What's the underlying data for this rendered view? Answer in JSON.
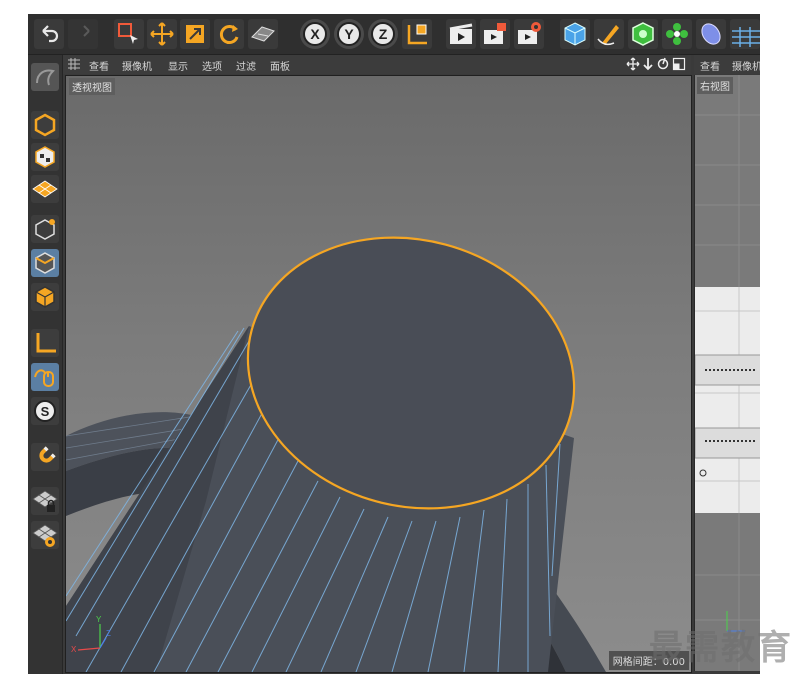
{
  "toolbar": {
    "axis_labels": [
      "X",
      "Y",
      "Z"
    ],
    "icons": [
      "undo-icon",
      "redo-icon",
      "live-select-icon",
      "move-icon",
      "scale-icon",
      "rotate-icon",
      "recent-tool-icon",
      "x-axis-lock-icon",
      "y-axis-lock-icon",
      "z-axis-lock-icon",
      "coordinate-system-icon",
      "render-view-icon",
      "render-to-picture-viewer-icon",
      "render-settings-icon",
      "cube-icon",
      "pen-spline-icon",
      "subdivision-surface-icon",
      "cloner-icon",
      "deformer-icon",
      "floor-icon"
    ]
  },
  "palette": {
    "icons": [
      "model-mode-icon",
      "object-mode-icon",
      "texture-mode-icon",
      "workplane-icon",
      "points-mode-icon",
      "edges-mode-icon",
      "polygons-mode-icon",
      "axis-mode-icon",
      "tweak-mode-icon",
      "solo-mode-icon",
      "snap-icon",
      "locked-workplane-icon",
      "planar-workplane-icon"
    ],
    "solo_label": "S"
  },
  "viewport_main": {
    "menu": [
      "查看",
      "摄像机",
      "显示",
      "选项",
      "过滤",
      "面板"
    ],
    "label": "透视视图",
    "status": "网格间距：0.00",
    "nav_icons": [
      "move-view-icon",
      "zoom-view-icon",
      "rotate-view-icon",
      "maximize-view-icon"
    ]
  },
  "viewport_right": {
    "menu": [
      "查看",
      "摄像机"
    ],
    "label": "右视图"
  },
  "watermark": "最需教育",
  "colors": {
    "accent_orange": "#f5a623",
    "wireframe_blue": "#7fb6e6",
    "surface": "#4a4f58",
    "toolbar_bg": "#2f2f2f",
    "active_tool": "#5b7fa3"
  }
}
